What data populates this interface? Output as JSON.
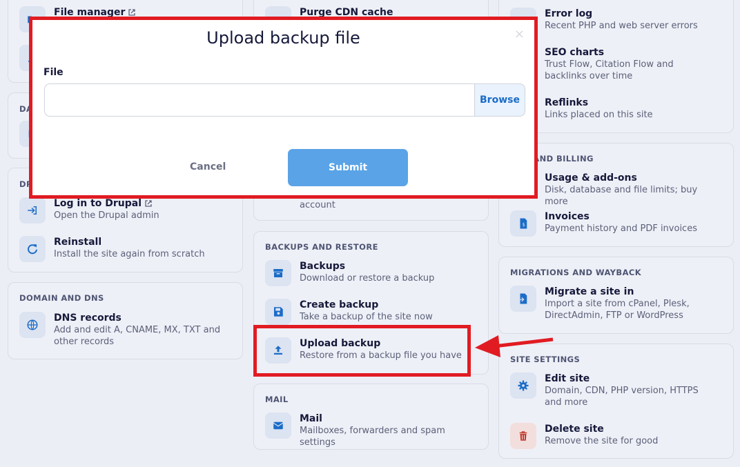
{
  "left": {
    "top_items": [
      {
        "title": "File manager",
        "desc": ""
      }
    ],
    "database": {
      "header": "DA"
    },
    "drupal": {
      "header": "DR",
      "items": [
        {
          "title": "Log in to Drupal",
          "desc": "Open the Drupal admin"
        },
        {
          "title": "Reinstall",
          "desc": "Install the site again from scratch"
        }
      ]
    },
    "dns": {
      "header": "DOMAIN AND DNS",
      "items": [
        {
          "title": "DNS records",
          "desc": "Add and edit A, CNAME, MX, TXT and other records"
        }
      ]
    }
  },
  "middle": {
    "top_item": {
      "title": "Purge CDN cache"
    },
    "partial_desc": "account",
    "backups": {
      "header": "BACKUPS AND RESTORE",
      "items": [
        {
          "title": "Backups",
          "desc": "Download or restore a backup"
        },
        {
          "title": "Create backup",
          "desc": "Take a backup of the site now"
        },
        {
          "title": "Upload backup",
          "desc": "Restore from a backup file you have"
        }
      ]
    },
    "mail": {
      "header": "MAIL",
      "items": [
        {
          "title": "Mail",
          "desc": "Mailboxes, forwarders and spam settings"
        }
      ]
    }
  },
  "right": {
    "top_items": [
      {
        "title": "Error log",
        "desc": "Recent PHP and web server errors"
      },
      {
        "title": "SEO charts",
        "desc": "Trust Flow, Citation Flow and backlinks over time"
      },
      {
        "title": "Reflinks",
        "desc": "Links placed on this site"
      }
    ],
    "billing": {
      "header": "ONS AND BILLING",
      "items": [
        {
          "title": "Usage & add-ons",
          "desc": "Disk, database and file limits; buy more"
        },
        {
          "title": "Invoices",
          "desc": "Payment history and PDF invoices"
        }
      ]
    },
    "migrations": {
      "header": "MIGRATIONS AND WAYBACK",
      "items": [
        {
          "title": "Migrate a site in",
          "desc": "Import a site from cPanel, Plesk, DirectAdmin, FTP or WordPress"
        }
      ]
    },
    "settings": {
      "header": "SITE SETTINGS",
      "items": [
        {
          "title": "Edit site",
          "desc": "Domain, CDN, PHP version, HTTPS and more"
        },
        {
          "title": "Delete site",
          "desc": "Remove the site for good"
        }
      ]
    }
  },
  "modal": {
    "title": "Upload backup file",
    "close": "×",
    "file_label": "File",
    "file_value": "",
    "browse_label": "Browse",
    "cancel_label": "Cancel",
    "submit_label": "Submit"
  },
  "colors": {
    "accent": "#1b6cc8",
    "highlight": "#e11b22",
    "submit": "#5aa3e6",
    "danger": "#c0392b"
  }
}
